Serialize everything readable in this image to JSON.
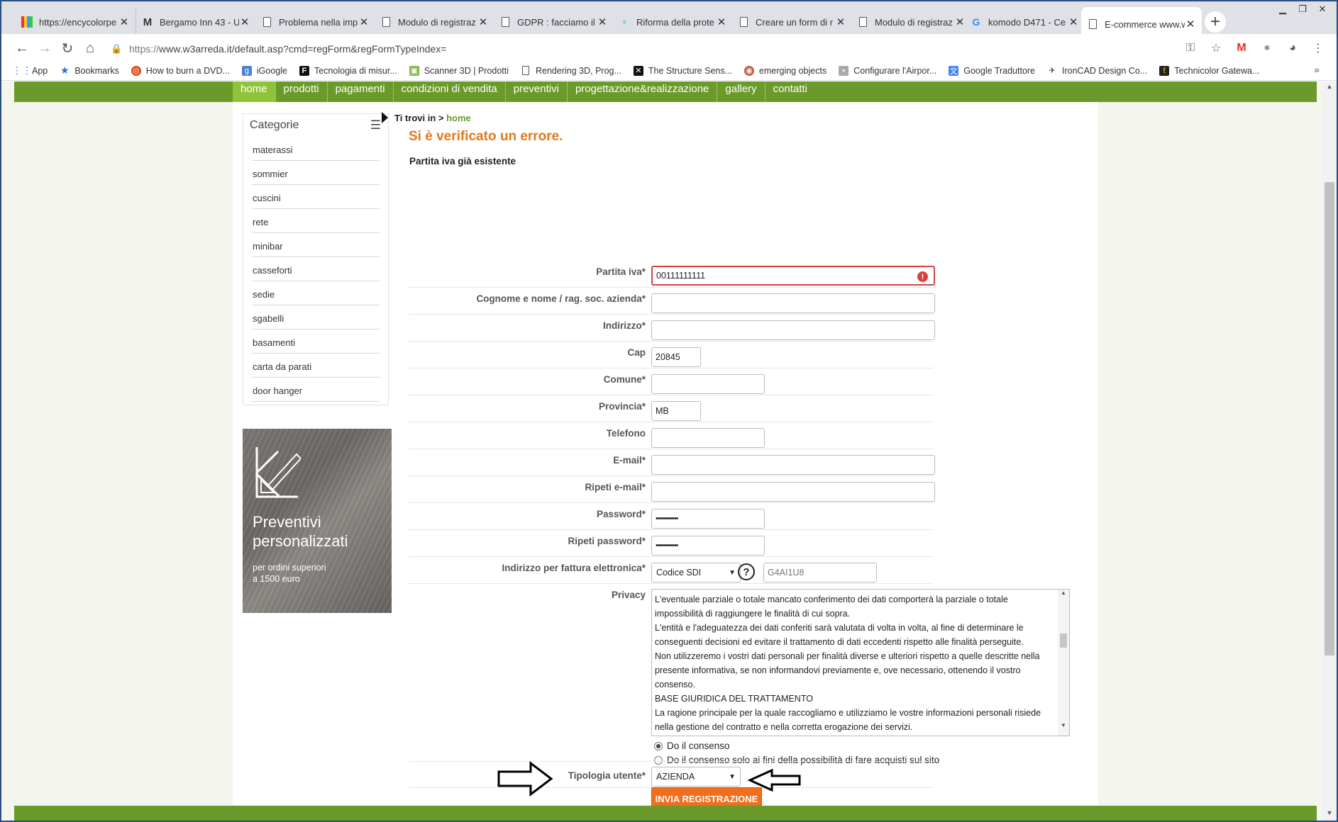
{
  "browser": {
    "tabs": [
      {
        "title": "https://encycolorpe",
        "icon": "colorbars-icon"
      },
      {
        "title": "Bergamo Inn 43 - U",
        "icon": "m-logo-icon"
      },
      {
        "title": "Problema nella imp",
        "icon": "document-icon"
      },
      {
        "title": "Modulo di registraz",
        "icon": "document-icon"
      },
      {
        "title": "GDPR : facciamo il p",
        "icon": "document-icon"
      },
      {
        "title": "Riforma della prote",
        "icon": "figure-icon"
      },
      {
        "title": "Creare un form di r",
        "icon": "document-icon"
      },
      {
        "title": "Modulo di registraz",
        "icon": "document-icon"
      },
      {
        "title": "komodo D471 - Ce",
        "icon": "google-icon"
      },
      {
        "title": "E-commerce www.w",
        "icon": "document-icon",
        "active": true
      }
    ],
    "url_scheme": "https://",
    "url_rest": "www.w3arreda.it/default.asp?cmd=regForm&regFormTypeIndex=",
    "bookmarks": [
      {
        "label": "App",
        "icon": "apps-grid-icon"
      },
      {
        "label": "Bookmarks",
        "icon": "star-icon"
      },
      {
        "label": "How to burn a DVD...",
        "icon": "ubuntu-icon"
      },
      {
        "label": "iGoogle",
        "icon": "igoogle-icon"
      },
      {
        "label": "Tecnologia di misur...",
        "icon": "f-logo-icon"
      },
      {
        "label": "Scanner 3D | Prodotti",
        "icon": "scanner-icon"
      },
      {
        "label": "Rendering 3D, Prog...",
        "icon": "document-icon"
      },
      {
        "label": "The Structure Sens...",
        "icon": "structure-icon"
      },
      {
        "label": "emerging objects",
        "icon": "lens-icon"
      },
      {
        "label": "Configurare l'Airpor...",
        "icon": "airport-icon"
      },
      {
        "label": "Google Traduttore",
        "icon": "translate-icon"
      },
      {
        "label": "IronCAD Design Co...",
        "icon": "bird-icon"
      },
      {
        "label": "Technicolor Gatewa...",
        "icon": "technicolor-icon"
      }
    ]
  },
  "site": {
    "nav": [
      "home",
      "prodotti",
      "pagamenti",
      "condizioni di vendita",
      "preventivi",
      "progettazione&realizzazione",
      "gallery",
      "contatti"
    ],
    "categories_title": "Categorie",
    "categories": [
      "materassi",
      "sommier",
      "cuscini",
      "rete",
      "minibar",
      "casseforti",
      "sedie",
      "sgabelli",
      "basamenti",
      "carta da parati",
      "door hanger"
    ],
    "promo": {
      "title_1": "Preventivi",
      "title_2": "personalizzati",
      "sub_1": "per ordini superiori",
      "sub_2": "a 1500 euro"
    },
    "breadcrumb_prefix": "Ti trovi in >",
    "breadcrumb_link": "home",
    "error_title": "Si è verificato un errore.",
    "error_message": "Partita iva già esistente",
    "form": {
      "partita_iva": {
        "label": "Partita iva*",
        "value": "00111111111"
      },
      "cognome": {
        "label": "Cognome e nome / rag. soc. azienda*",
        "value": ""
      },
      "indirizzo": {
        "label": "Indirizzo*",
        "value": ""
      },
      "cap": {
        "label": "Cap",
        "value": "20845"
      },
      "comune": {
        "label": "Comune*",
        "value": ""
      },
      "provincia": {
        "label": "Provincia*",
        "value": "MB"
      },
      "telefono": {
        "label": "Telefono",
        "value": ""
      },
      "email": {
        "label": "E-mail*",
        "value": ""
      },
      "email2": {
        "label": "Ripeti e-mail*",
        "value": ""
      },
      "password": {
        "label": "Password*",
        "value": "•••••••••••"
      },
      "password2": {
        "label": "Ripeti password*",
        "value": "•••••••••••"
      },
      "fattura": {
        "label": "Indirizzo per fattura elettronica*",
        "select": "Codice SDI",
        "value": "G4AI1U8"
      },
      "privacy": {
        "label": "Privacy",
        "text": "L'eventuale parziale o totale mancato conferimento dei dati comporterà la parziale o totale impossibilità di raggiungere le finalità di cui sopra.\nL'entità e l'adeguatezza dei dati conferiti sarà valutata di volta in volta, al fine di determinare le conseguenti decisioni ed evitare il trattamento di dati eccedenti rispetto alle finalità perseguite.\nNon utilizzeremo i vostri dati personali per finalità diverse e ulteriori rispetto a quelle descritte nella presente informativa, se non informandovi previamente e, ove necessario, ottenendo il vostro consenso.\nBASE GIURIDICA DEL TRATTAMENTO\nLa ragione principale per la quale raccogliamo e utilizziamo le vostre informazioni personali risiede nella gestione del contratto e nella corretta erogazione dei servizi."
      },
      "consent_1": "Do il consenso",
      "consent_2": "Do il consenso solo ai fini della possibilità di fare acquisti sul sito",
      "tipologia": {
        "label": "Tipologia utente*",
        "value": "AZIENDA"
      },
      "submit": "INVIA REGISTRAZIONE"
    }
  },
  "colors": {
    "green": "#6a9a2a",
    "nav_active": "#8fc43a",
    "error": "#d94040",
    "orange": "#f06e1e",
    "title_orange": "#e07a1a"
  }
}
